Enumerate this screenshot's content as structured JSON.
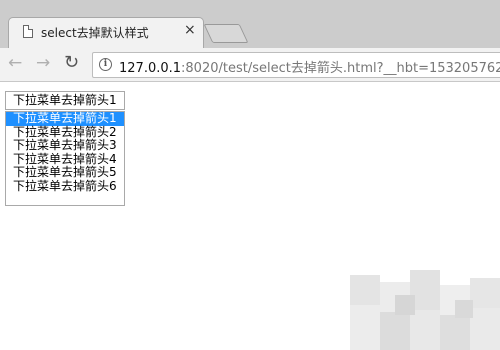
{
  "browser": {
    "tab_title": "select去掉默认样式",
    "tab_close": "×",
    "url_host": "127.0.0.1",
    "url_rest": ":8020/test/select去掉箭头.html?__hbt=153205762"
  },
  "icons": {
    "back": "back-arrow-icon",
    "forward": "forward-arrow-icon",
    "reload": "reload-icon",
    "info": "info-icon",
    "page": "page-icon"
  },
  "page": {
    "dropdown_value": "下拉菜单去掉箭头1",
    "options": [
      "下拉菜单去掉箭头1",
      "下拉菜单去掉箭头2",
      "下拉菜单去掉箭头3",
      "下拉菜单去掉箭头4",
      "下拉菜单去掉箭头5",
      "下拉菜单去掉箭头6"
    ],
    "selected_option": "下拉菜单去掉箭头1"
  },
  "colors": {
    "selection": "#1e90ff",
    "tabstrip": "#cccccc",
    "toolbar": "#f2f2f2"
  }
}
